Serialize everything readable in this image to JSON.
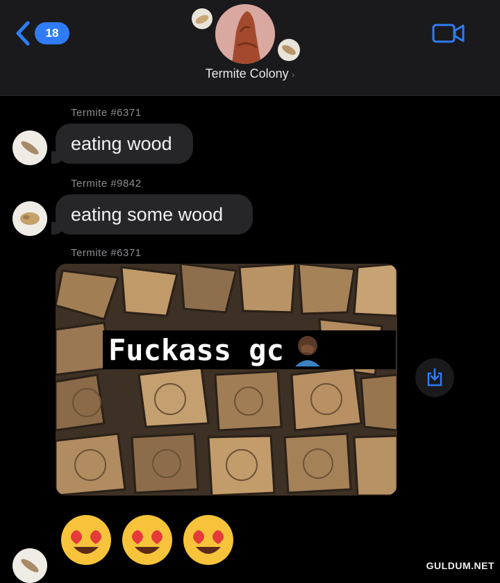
{
  "header": {
    "back_count": "18",
    "group_name": "Termite Colony",
    "title_chevron": "›",
    "video_icon": "video-camera-icon"
  },
  "messages": [
    {
      "sender": "Termite #6371",
      "text": "eating wood"
    },
    {
      "sender": "Termite #9842",
      "text": "eating some wood"
    },
    {
      "sender": "Termite #6371",
      "image": "firewood-photo",
      "caption": "Fuckass gc"
    }
  ],
  "reactions": [
    "😍",
    "😍",
    "😍"
  ],
  "save_icon": "download-icon",
  "watermark": "GULDUM.NET",
  "colors": {
    "accent": "#2f7cf6",
    "bubble": "#262628",
    "background": "#000000"
  }
}
